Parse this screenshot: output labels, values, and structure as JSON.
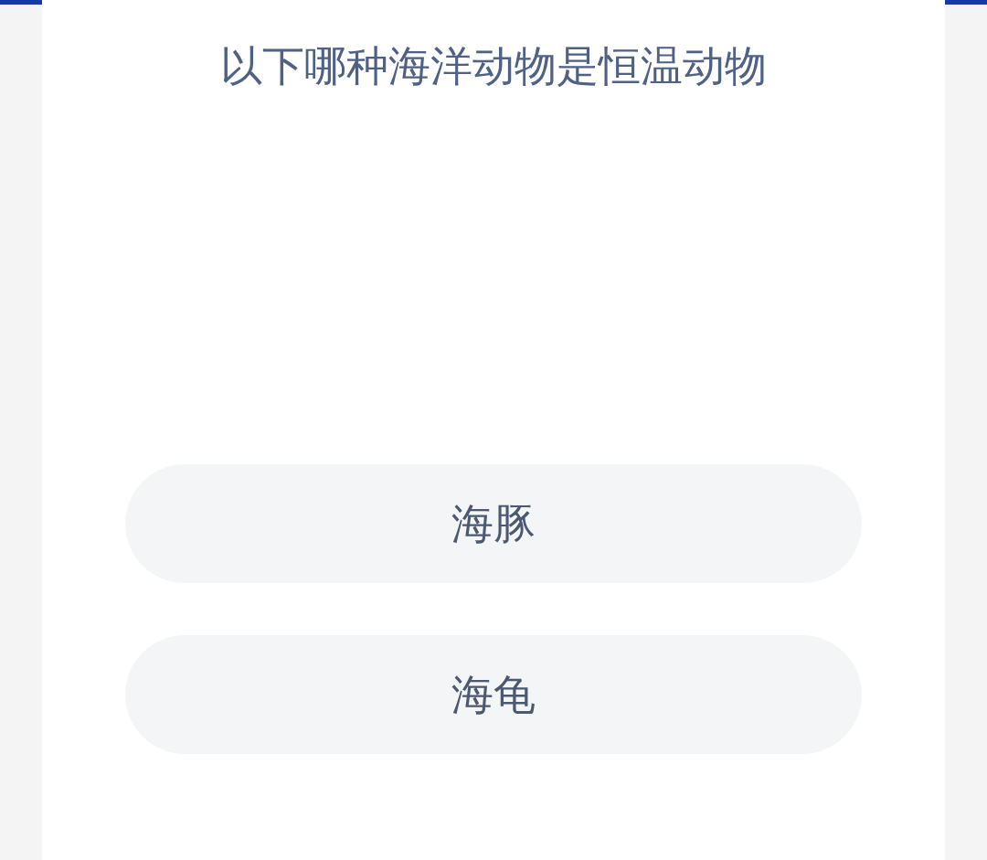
{
  "question": "以下哪种海洋动物是恒温动物",
  "options": [
    {
      "label": "海豚"
    },
    {
      "label": "海龟"
    }
  ]
}
